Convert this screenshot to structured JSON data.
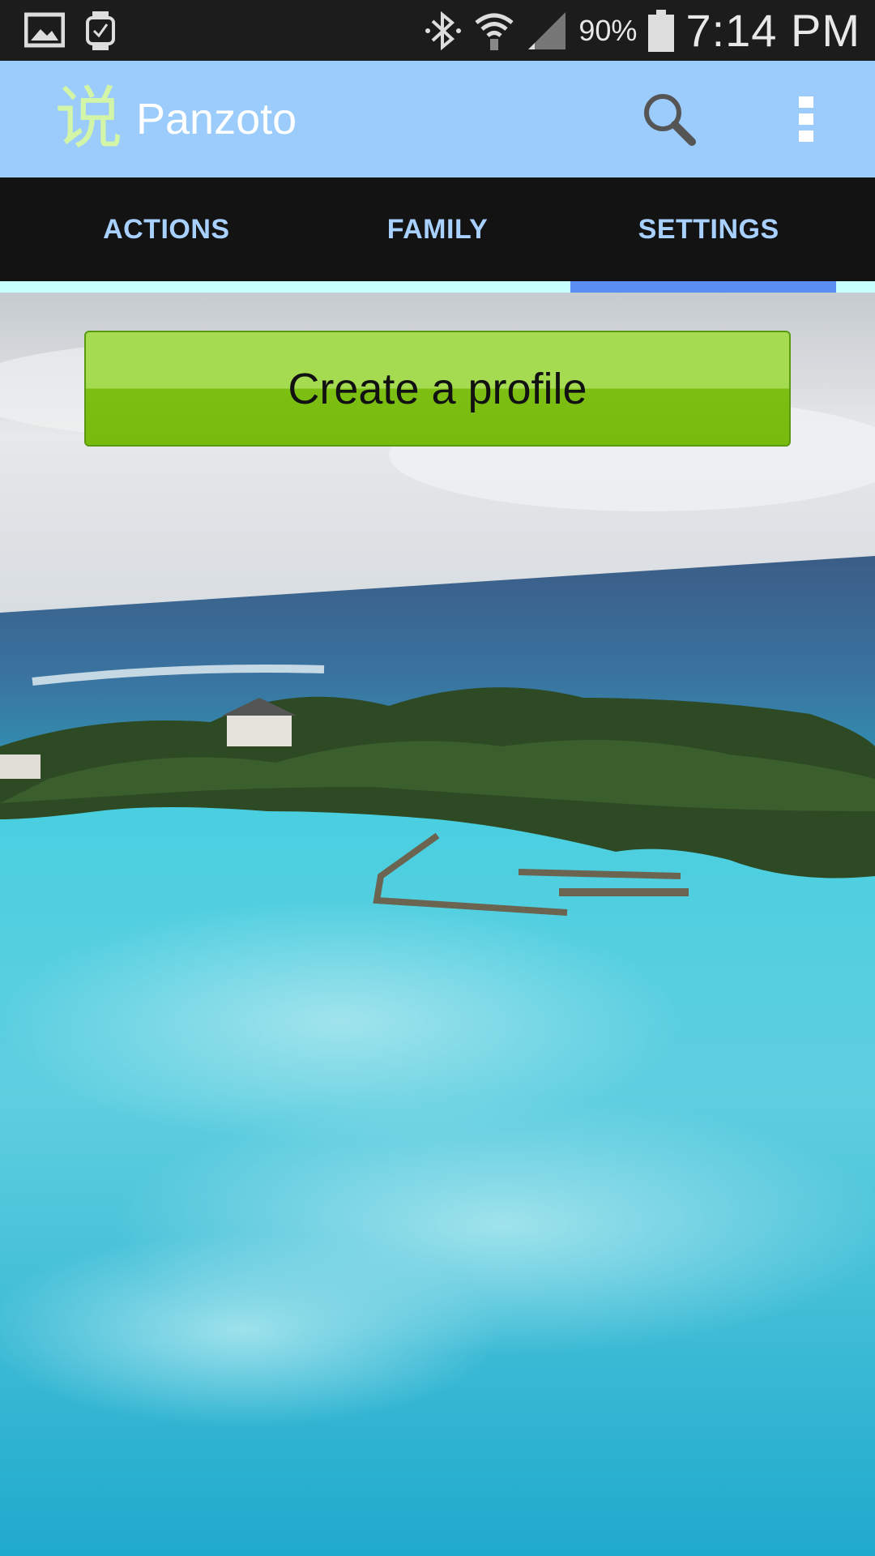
{
  "status_bar": {
    "battery_percent": "90%",
    "time": "7:14 PM",
    "icons": [
      "gallery-icon",
      "watch-icon",
      "bluetooth-icon",
      "wifi-icon",
      "signal-icon",
      "battery-icon"
    ]
  },
  "action_bar": {
    "logo_glyph": "说",
    "title": "Panzoto",
    "icons": [
      "search-icon",
      "overflow-menu-icon"
    ]
  },
  "tabs": [
    {
      "label": "ACTIONS"
    },
    {
      "label": "FAMILY"
    },
    {
      "label": "SETTINGS",
      "selected": true
    }
  ],
  "main": {
    "create_profile_label": "Create a profile"
  },
  "colors": {
    "action_bar": "#9bccfb",
    "tab_bar": "#131313",
    "tab_text": "#a9d1ff",
    "tab_indicator": "#5b8ef3",
    "button_green": "#7dbf12"
  }
}
